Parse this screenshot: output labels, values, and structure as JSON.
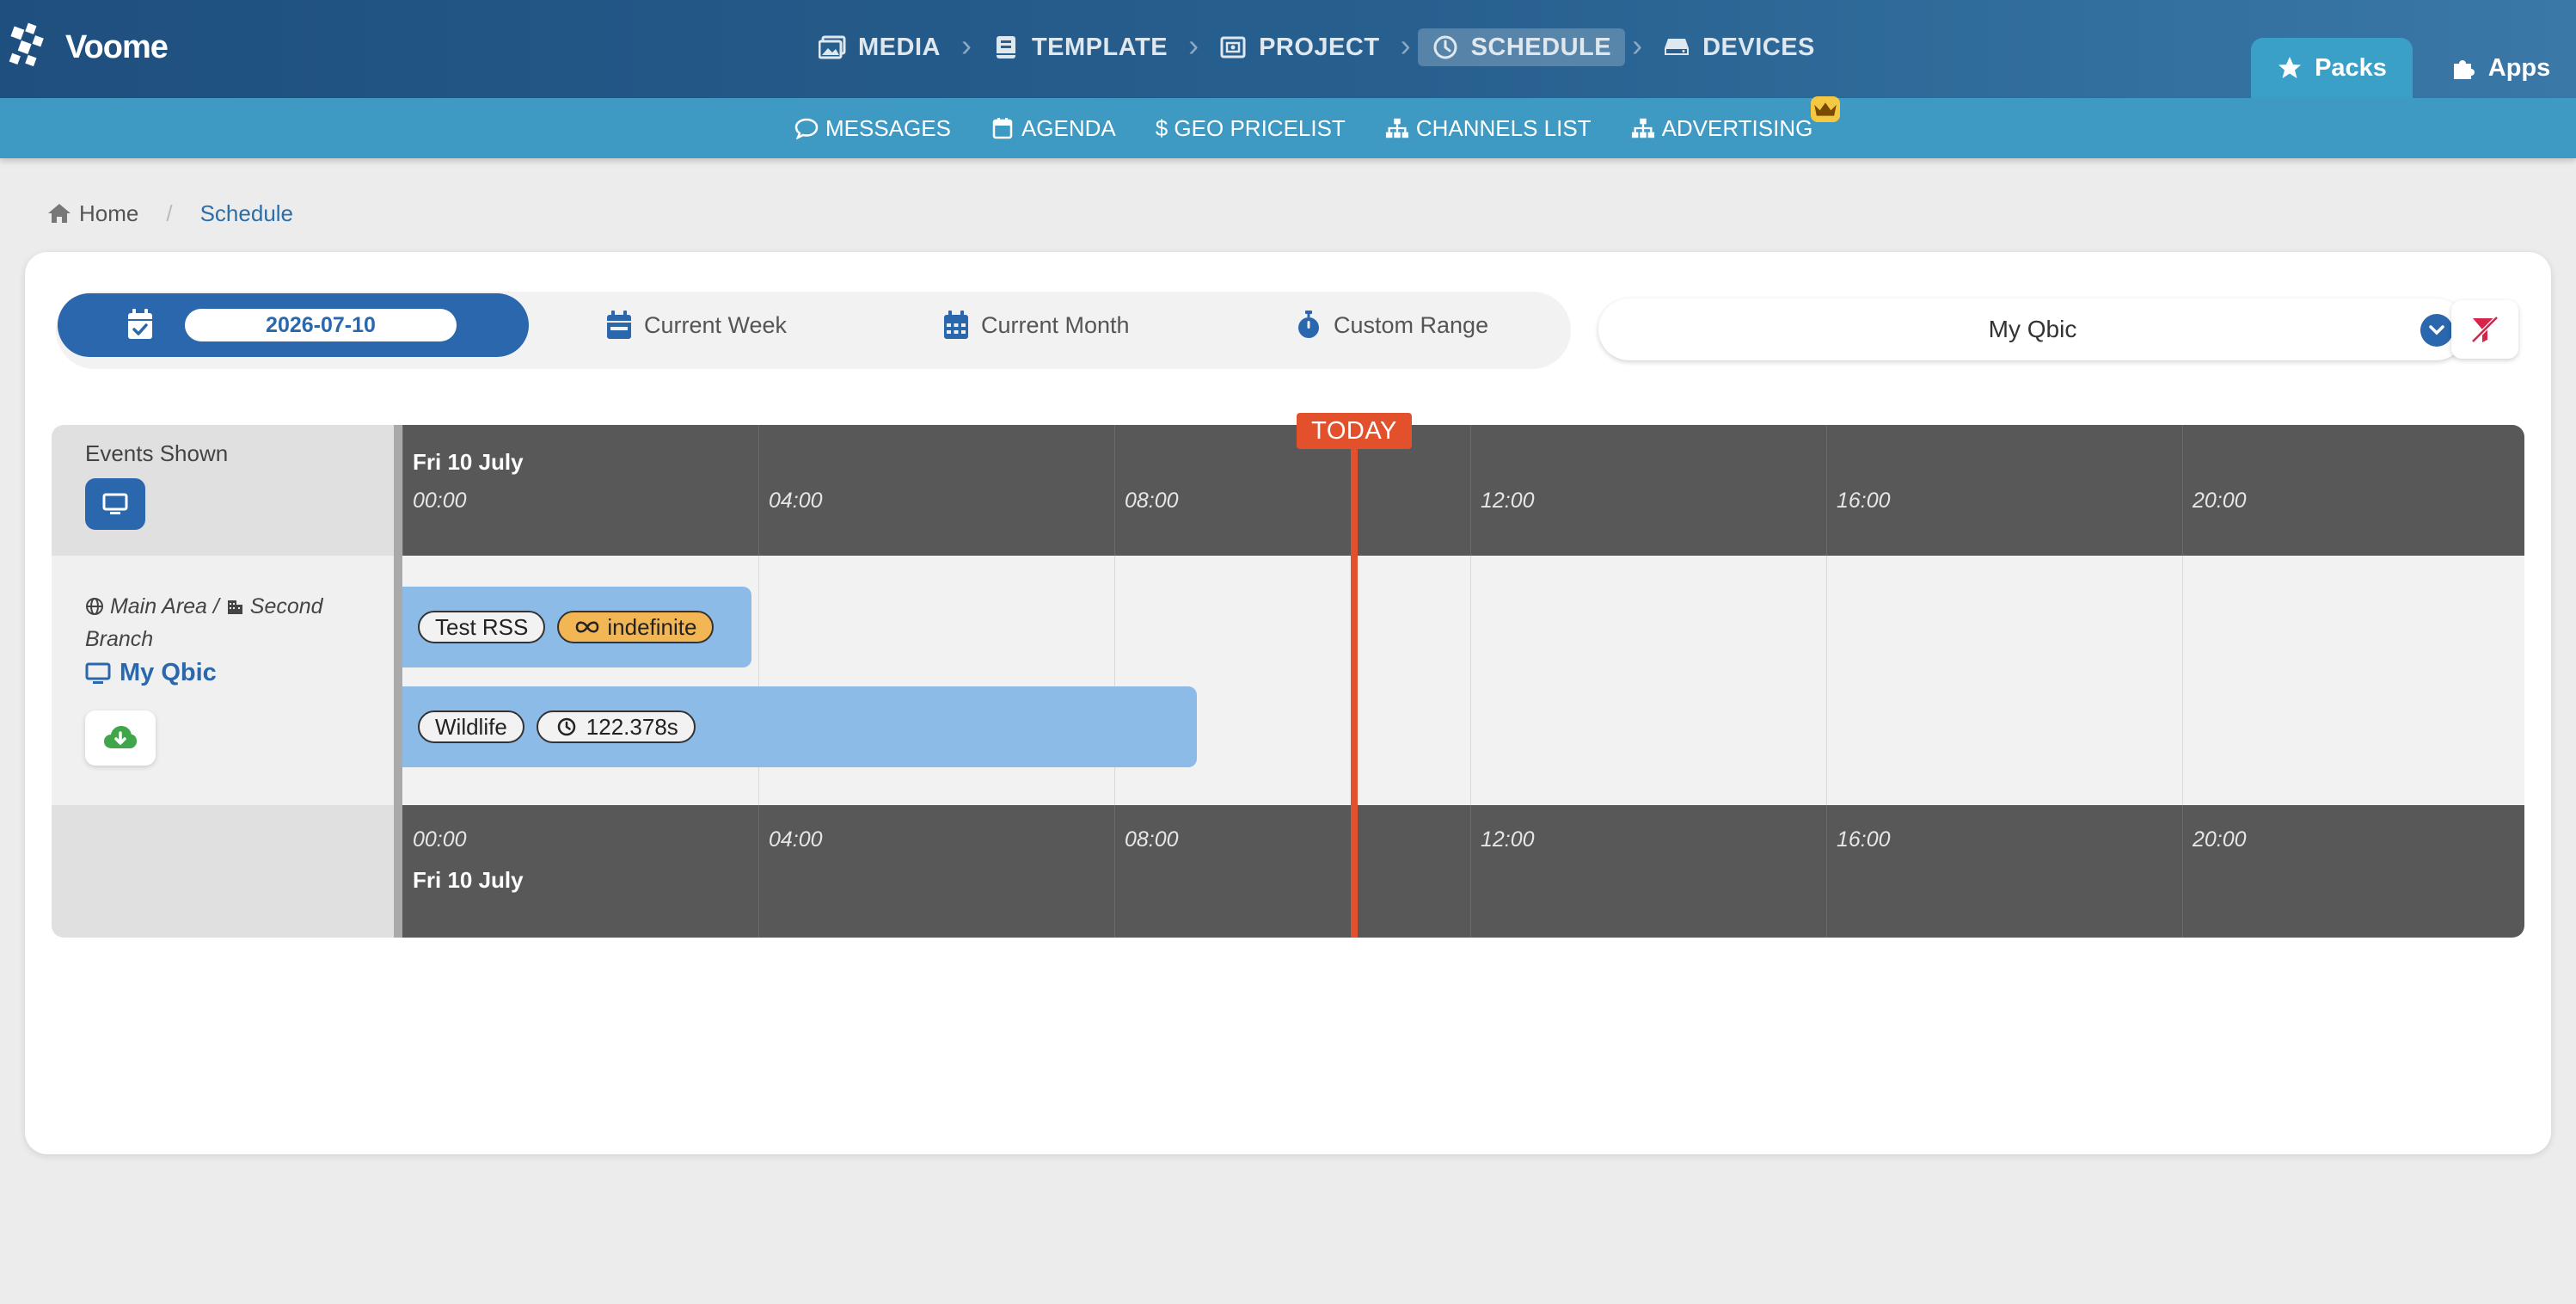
{
  "brand": {
    "name": "Voome"
  },
  "main_nav": [
    {
      "label": "MEDIA",
      "icon": "images-icon"
    },
    {
      "label": "TEMPLATE",
      "icon": "book-icon"
    },
    {
      "label": "PROJECT",
      "icon": "project-icon"
    },
    {
      "label": "SCHEDULE",
      "icon": "clock-icon",
      "active": true
    },
    {
      "label": "DEVICES",
      "icon": "hdd-icon"
    }
  ],
  "corner_tabs": {
    "packs": "Packs",
    "apps": "Apps"
  },
  "sub_nav": [
    {
      "label": "MESSAGES",
      "icon": "comment-icon"
    },
    {
      "label": "AGENDA",
      "icon": "calendar-icon"
    },
    {
      "label": "$ GEO PRICELIST",
      "icon": "dollar-icon"
    },
    {
      "label": "CHANNELS LIST",
      "icon": "sitemap-icon"
    },
    {
      "label": "ADVERTISING",
      "icon": "sitemap-icon",
      "badge": "crown-icon"
    }
  ],
  "breadcrumb": {
    "home": "Home",
    "current": "Schedule"
  },
  "range_selector": {
    "date_value": "2026-07-10",
    "current_week": "Current Week",
    "current_month": "Current Month",
    "custom_range": "Custom Range"
  },
  "device_filter": {
    "selected": "My Qbic"
  },
  "timeline": {
    "events_shown_label": "Events Shown",
    "area_path": {
      "area": "Main Area",
      "branch": "Second Branch"
    },
    "device_name": "My Qbic",
    "day_label": "Fri 10 July",
    "hours": [
      "00:00",
      "04:00",
      "08:00",
      "12:00",
      "16:00",
      "20:00"
    ],
    "today_label": "TODAY",
    "events": [
      {
        "name": "Test RSS",
        "badge": "indefinite",
        "badge_icon": "infinity-icon"
      },
      {
        "name": "Wildlife",
        "badge": "122.378s",
        "badge_icon": "clock-icon"
      }
    ]
  },
  "colors": {
    "primary": "#2a67ad",
    "subbar": "#3e9ac3",
    "today": "#e2512b",
    "event": "#8dbbe8",
    "indefinite_badge": "#f3b655"
  }
}
